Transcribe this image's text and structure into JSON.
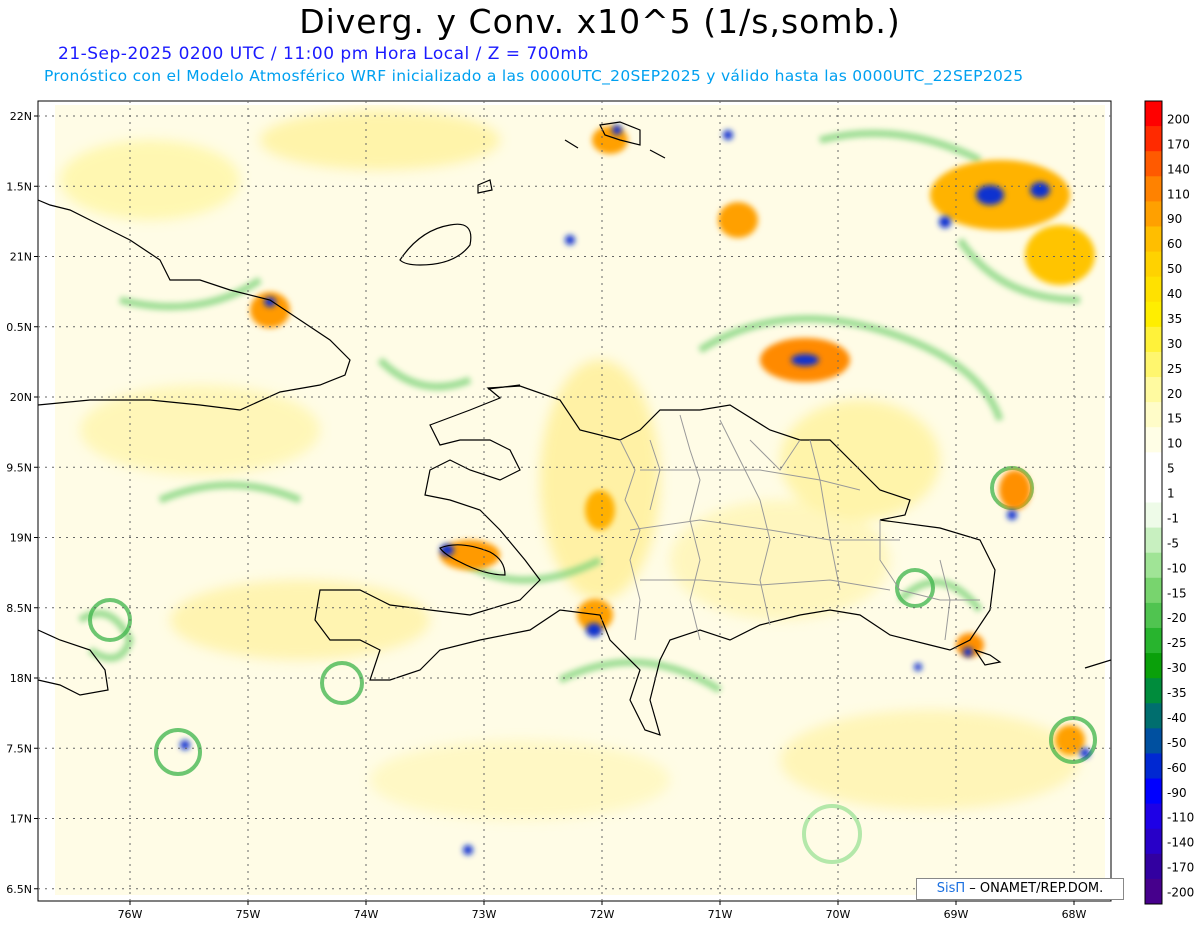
{
  "header": {
    "title": "Diverg. y Conv. x10^5 (1/s,somb.)",
    "subtitle_1": "21-Sep-2025 0200 UTC / 11:00 pm Hora Local / Z = 700mb",
    "subtitle_2": "Pronóstico con el Modelo Atmosférico WRF inicializado a las 0000UTC_20SEP2025 y válido hasta las  0000UTC_22SEP2025"
  },
  "axes": {
    "lat_labels": [
      "22N",
      "1.5N",
      "21N",
      "0.5N",
      "20N",
      "9.5N",
      "19N",
      "8.5N",
      "18N",
      "7.5N",
      "17N",
      "6.5N"
    ],
    "lat_values": [
      22,
      21.5,
      21,
      20.5,
      20,
      19.5,
      19,
      18.5,
      18,
      17.5,
      17,
      16.5
    ],
    "lon_labels": [
      "76W",
      "75W",
      "74W",
      "73W",
      "72W",
      "71W",
      "70W",
      "69W",
      "68W"
    ],
    "lon_values": [
      -76,
      -75,
      -74,
      -73,
      -72,
      -71,
      -70,
      -69,
      -68
    ]
  },
  "colorbar": {
    "labels": [
      "200",
      "170",
      "140",
      "110",
      "90",
      "60",
      "50",
      "40",
      "35",
      "30",
      "25",
      "20",
      "15",
      "10",
      "5",
      "1",
      "-1",
      "-5",
      "-10",
      "-15",
      "-20",
      "-25",
      "-30",
      "-35",
      "-40",
      "-50",
      "-60",
      "-90",
      "-110",
      "-140",
      "-170",
      "-200"
    ],
    "colors": [
      "#ff0000",
      "#ff2a00",
      "#ff5a00",
      "#ff8200",
      "#ffa000",
      "#ffbe00",
      "#ffd200",
      "#ffe100",
      "#ffee00",
      "#fff23a",
      "#fff66e",
      "#fffaa0",
      "#fffcc8",
      "#fffee6",
      "#ffffff",
      "#ffffff",
      "#eefbe8",
      "#c8f0c0",
      "#a0e496",
      "#78d46e",
      "#50c450",
      "#28b42e",
      "#0aa00a",
      "#008c3c",
      "#006e6e",
      "#0050a0",
      "#0028d2",
      "#0000ff",
      "#1e00e6",
      "#2800c8",
      "#3200a0",
      "#46008c"
    ]
  },
  "credit": {
    "logo": "SisΠ",
    "text": "– ONAMET/REP.DOM."
  }
}
